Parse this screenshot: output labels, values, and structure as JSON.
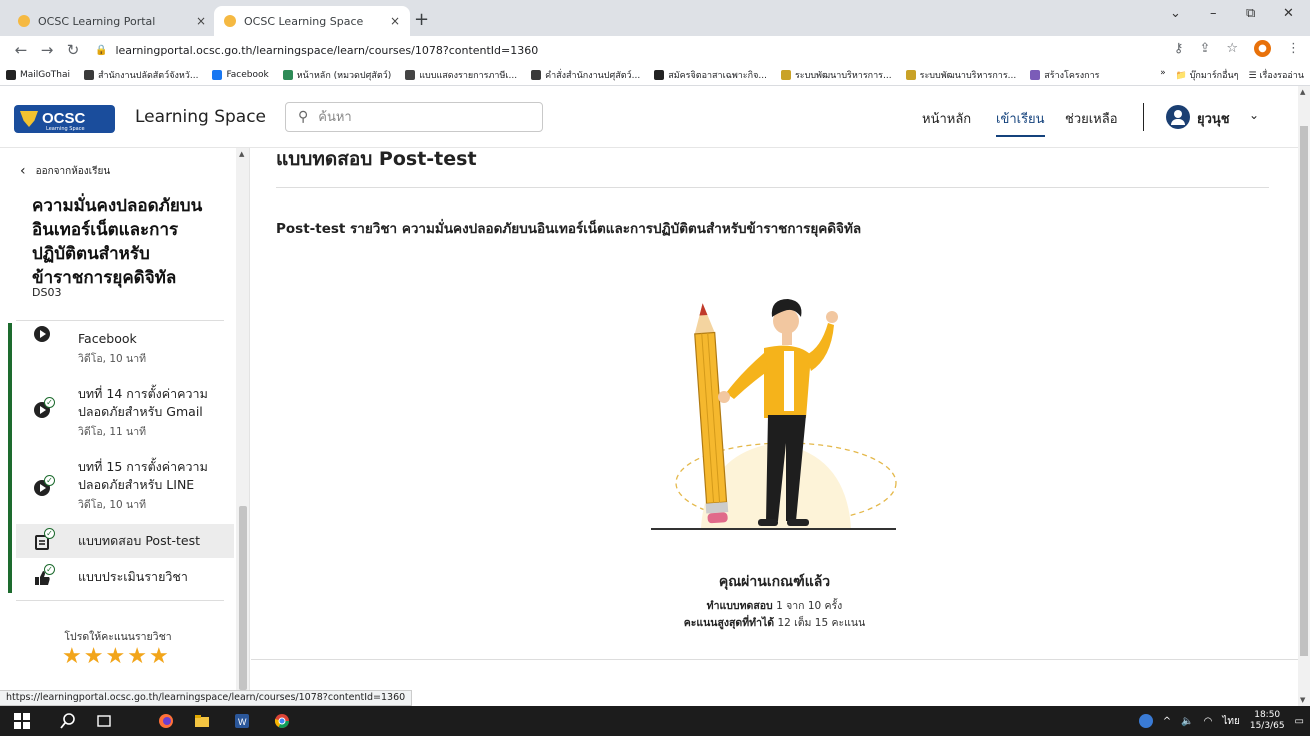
{
  "browser": {
    "tabs": [
      {
        "title": "OCSC Learning Portal",
        "close": "×"
      },
      {
        "title": "OCSC Learning Space",
        "close": "×"
      }
    ],
    "new_tab": "+",
    "window_controls": [
      "⌄",
      "–",
      "⧉",
      "✕"
    ],
    "url": "learningportal.ocsc.go.th/learningspace/learn/courses/1078?contentId=1360",
    "bookmarks": [
      {
        "label": "MailGoThai",
        "color": "#222222"
      },
      {
        "label": "สำนักงานปลัดสัตว์จังหวั...",
        "color": "#3a3a3a"
      },
      {
        "label": "Facebook",
        "color": "#1877f2"
      },
      {
        "label": "หน้าหลัก (หมวดปศุสัตว์)",
        "color": "#2e8b57"
      },
      {
        "label": "แบบแสดงรายการภาษีเ...",
        "color": "#444444"
      },
      {
        "label": "คำสั่งสำนักงานปศุสัตว์...",
        "color": "#3a3a3a"
      },
      {
        "label": "สมัครจิตอาสาเฉพาะกิจ...",
        "color": "#222222"
      },
      {
        "label": "ระบบพัฒนาบริหารการ...",
        "color": "#c9a227"
      },
      {
        "label": "ระบบพัฒนาบริหารการ...",
        "color": "#c9a227"
      },
      {
        "label": "สร้างโครงการ",
        "color": "#7b5cb8"
      }
    ],
    "bookmarks_more": "»",
    "other_bookmarks": "บุ๊กมาร์กอื่นๆ",
    "reading_list": "เรื่องรออ่าน",
    "status_url": "https://learningportal.ocsc.go.th/learningspace/learn/courses/1078?contentId=1360"
  },
  "header": {
    "logo_text": "OCSC",
    "logo_sub": "Learning Space",
    "site_title": "Learning Space",
    "search_placeholder": "ค้นหา",
    "nav": [
      "หน้าหลัก",
      "เข้าเรียน",
      "ช่วยเหลือ"
    ],
    "active_nav": "เข้าเรียน",
    "user_name": "ยุวนุช"
  },
  "sidebar": {
    "back_label": "ออกจากห้องเรียน",
    "course_title": "ความมั่นคงปลอดภัยบนอินเทอร์เน็ตและการปฏิบัติตนสำหรับข้าราชการยุคดิจิทัล",
    "course_code": "DS03",
    "items": [
      {
        "name": "Facebook",
        "meta": "วิดีโอ, 10 นาที",
        "type": "video"
      },
      {
        "name": "บทที่ 14 การตั้งค่าความปลอดภัยสำหรับ Gmail",
        "meta": "วิดีโอ, 11 นาที",
        "type": "video"
      },
      {
        "name": "บทที่ 15 การตั้งค่าความปลอดภัยสำหรับ LINE",
        "meta": "วิดีโอ, 10 นาที",
        "type": "video"
      },
      {
        "name": "แบบทดสอบ Post-test",
        "meta": "",
        "type": "quiz"
      },
      {
        "name": "แบบประเมินรายวิชา",
        "meta": "",
        "type": "survey"
      }
    ],
    "rating_label": "โปรดให้คะแนนรายวิชา",
    "stars": 5
  },
  "main": {
    "title": "แบบทดสอบ Post-test",
    "subject_line": "Post-test รายวิชา ความมั่นคงปลอดภัยบนอินเทอร์เน็ตและการปฏิบัติตนสำหรับข้าราชการยุคดิจิทัล",
    "pass_message": "คุณผ่านเกณฑ์แล้ว",
    "attempts_label": "ทำแบบทดสอบ",
    "attempts_value": "1 จาก 10 ครั้ง",
    "score_label": "คะแนนสูงสุดที่ทำได้",
    "score_value": "12 เต็ม 15 คะแนน"
  },
  "taskbar": {
    "time": "18:50",
    "date": "15/3/65",
    "lang": "ไทย"
  }
}
